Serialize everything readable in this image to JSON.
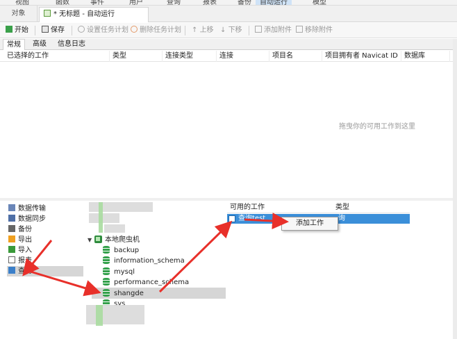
{
  "menubar": {
    "items": [
      "视图",
      "函数",
      "事件",
      "用户",
      "查询",
      "报表",
      "备份",
      "自动运行",
      "模型"
    ],
    "active_index": 7
  },
  "tabs": {
    "objects": "对象",
    "current": "* 无标题 - 自动运行"
  },
  "toolbar": {
    "start": "开始",
    "save": "保存",
    "set_schedule": "设置任务计划",
    "delete_schedule": "删除任务计划",
    "move_up": "上移",
    "move_down": "下移",
    "add_attachment": "添加附件",
    "remove_attachment": "移除附件"
  },
  "subtabs": [
    "常规",
    "高级",
    "信息日志"
  ],
  "selected_jobs": {
    "columns": [
      "已选择的工作",
      "类型",
      "连接类型",
      "连接",
      "项目名",
      "项目拥有者 Navicat ID",
      "数据库"
    ],
    "placeholder": "拖曳你的可用工作到这里"
  },
  "job_types": [
    {
      "label": "数据传输",
      "icon": "data-transfer-icon"
    },
    {
      "label": "数据同步",
      "icon": "data-sync-icon"
    },
    {
      "label": "备份",
      "icon": "backup-icon"
    },
    {
      "label": "导出",
      "icon": "export-icon"
    },
    {
      "label": "导入",
      "icon": "import-icon"
    },
    {
      "label": "报表",
      "icon": "report-icon"
    },
    {
      "label": "查询",
      "icon": "query-icon"
    }
  ],
  "tree": {
    "connection": "本地爬虫机",
    "databases": [
      "backup",
      "information_schema",
      "mysql",
      "performance_schema",
      "shangde",
      "sys"
    ]
  },
  "available_jobs": {
    "columns": [
      "可用的工作",
      "类型"
    ],
    "rows": [
      {
        "name": "查询test",
        "type": "询"
      }
    ]
  },
  "context_menu": {
    "add_job": "添加工作"
  },
  "colors": {
    "selection": "#3b8fd9",
    "arrow": "#e8302a",
    "db_icon": "#32a04a"
  }
}
